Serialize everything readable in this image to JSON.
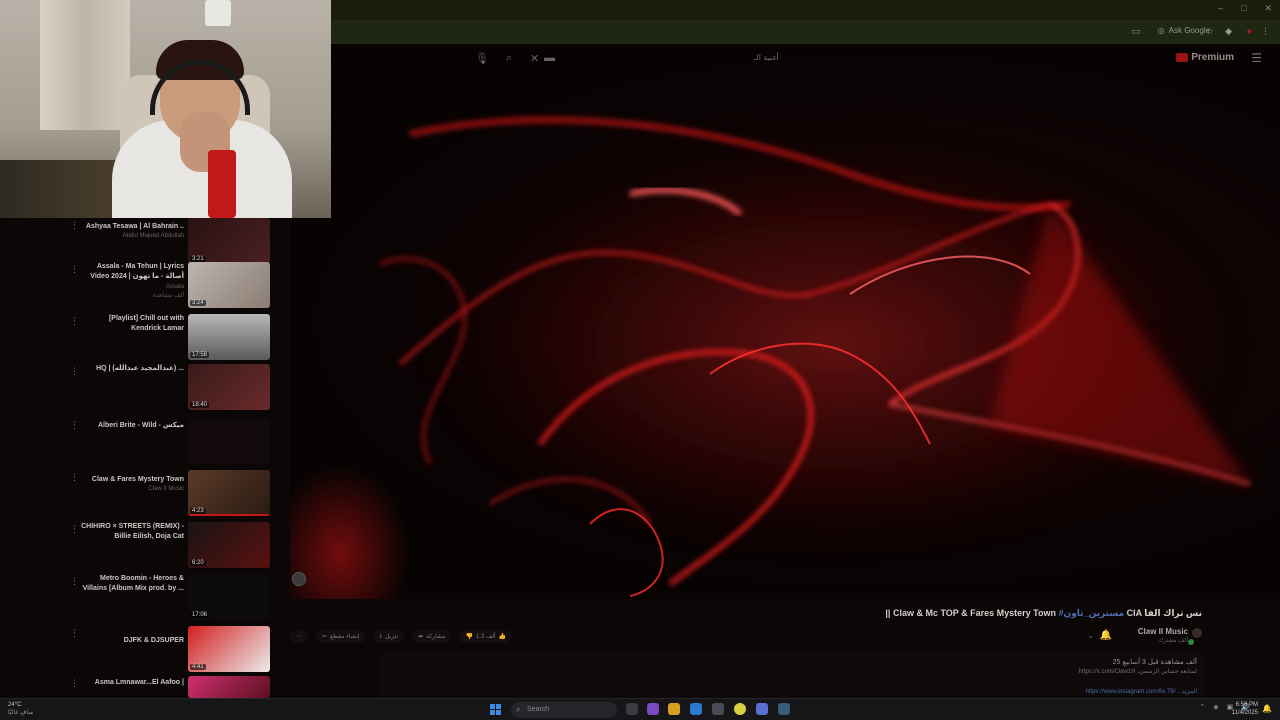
{
  "browser": {
    "ask_google": "Ask Google"
  },
  "yt_header": {
    "search_query": "أغنية الـ",
    "premium_label": "Premium"
  },
  "sidebar": {
    "items": [
      {
        "title": "Ashyaa Tesawa | Al Bahrain ..",
        "channel": "Abdul Majeed Abdullah",
        "meta": "",
        "duration": "3:21"
      },
      {
        "title": "Assala - Ma Tehun | Lyrics Video 2024 | أصالة - ما تهون",
        "channel": "Assala",
        "meta": "ألف مشاهدة",
        "duration": "3:24"
      },
      {
        "title": "[Playlist] Chill out with Kendrick Lamar",
        "channel": "",
        "meta": "",
        "duration": "17:58"
      },
      {
        "title": "HQ | (عبدالمجيد عبدالله) ...",
        "channel": "",
        "meta": "",
        "duration": "18:40"
      },
      {
        "title": "Alberi Brite - Wild - ميكس",
        "channel": "",
        "meta": "",
        "duration": ""
      },
      {
        "title": "Claw & Fares Mystery Town",
        "channel": "Claw II Music",
        "meta": "",
        "duration": "4:23"
      },
      {
        "title": "CHIHIRO × STREETS (REMIX) - Billie Eilish, Doja Cat",
        "channel": "",
        "meta": "",
        "duration": "6:20"
      },
      {
        "title": "Metro Boomin - Heroes & Villains [Album Mix prod. by ...",
        "channel": "",
        "meta": "",
        "duration": "17:06"
      },
      {
        "title": "DJFK & DJSUPER",
        "channel": "",
        "meta": "",
        "duration": "4:41"
      },
      {
        "title": "Asma Lmnawar...El Aafoo |",
        "channel": "",
        "meta": "",
        "duration": ""
      }
    ]
  },
  "video_info": {
    "title_prefix": "|| Claw & Mc TOP & Fares Mystery Town",
    "title_tag": "#مسترين_تاون",
    "title_suffix": "CIA نس تراك الفا",
    "channel_name": "Claw II Music",
    "channel_subs": "ألف مشترك",
    "actions": {
      "like_count": "1.3 ألف",
      "share": "مشاركة",
      "download": "تنزيل",
      "clip": "إنشاء مقطع"
    },
    "description": {
      "line1": "25 ألف مشاهدة قبل 3 أسابيع",
      "line2": "https://x.com/Claw1H ،لمتابعة حسابي الرسمي",
      "line3": "https://www.instagram.com/6x.79/ ...المزيد"
    }
  },
  "taskbar": {
    "weather_temp": "24°C",
    "weather_desc": "صافٍ غالبًا",
    "search_placeholder": "Search",
    "clock_time": "6:56 PM",
    "clock_date": "11/4/2025"
  },
  "colors": {
    "accent_red": "#c21818",
    "link_blue": "#4f6fb0"
  }
}
